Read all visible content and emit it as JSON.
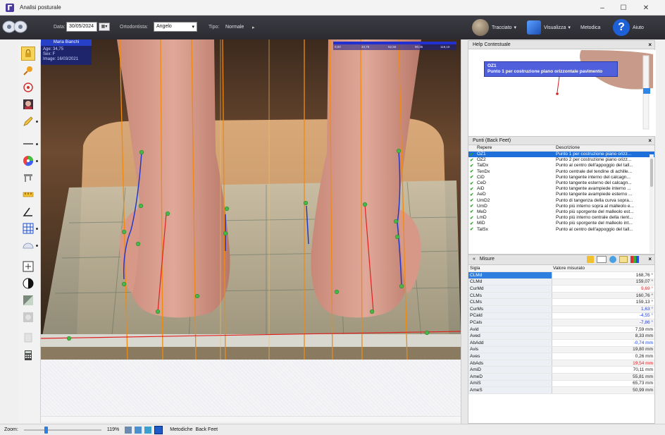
{
  "window": {
    "title": "Analisi posturale",
    "controls": [
      "–",
      "☐",
      "✕"
    ]
  },
  "toolbar": {
    "date_label": "Data:",
    "date_value": "30/05/2024",
    "orthodontist_label": "Ortodontista:",
    "orthodontist_value": "Angelo",
    "type_label": "Tipo:",
    "type_value": "Normale",
    "tracciato_label": "Tracciato",
    "visualizza_label": "Visualizza",
    "metodica_label": "Metodica",
    "aiuto_label": "Aiuto"
  },
  "patient": {
    "name": "Maria Bianchi",
    "age": "Age: 34,75",
    "sex": "Sex: F",
    "image_date": "Image: 16/03/2021"
  },
  "scale_ticks": [
    "0,00",
    "34,75",
    "62,55",
    "90,35",
    "118,10"
  ],
  "help": {
    "title": "Help Contestuale",
    "point_code": "OZ1",
    "point_desc": "Punto 1 per costruzione piano orizzontale pavimento"
  },
  "points": {
    "title": "Punti  (Back Feet)",
    "col_repere": "Repere",
    "col_desc": "Descrizione",
    "rows": [
      {
        "code": "OZ1",
        "desc": "Punto 1 per costruzione piano orizz...",
        "selected": true
      },
      {
        "code": "OZ2",
        "desc": "Punto 2 per costruzione piano orizz..."
      },
      {
        "code": "TalDx",
        "desc": "Punto al centro dell'appoggio del tall..."
      },
      {
        "code": "TenDx",
        "desc": "Punto centrale del tendine di achille..."
      },
      {
        "code": "CiD",
        "desc": "Punto tangente interno del calcagn..."
      },
      {
        "code": "CeD",
        "desc": "Punto tangente esterno del calcagn..."
      },
      {
        "code": "AiD",
        "desc": "Punto tangente avampiede interno ..."
      },
      {
        "code": "AeD",
        "desc": "Punto tangente avampiede esterno ..."
      },
      {
        "code": "UmD2",
        "desc": "Punto di tangenza della curva sopra..."
      },
      {
        "code": "UmD",
        "desc": "Punto più interno sopra al malleolo e..."
      },
      {
        "code": "MeD",
        "desc": "Punto più sporgente del malleolo est..."
      },
      {
        "code": "LmD",
        "desc": "Punto più interno centrale della rient..."
      },
      {
        "code": "MiD",
        "desc": "Punto più sporgente del malleolo int..."
      },
      {
        "code": "TalSx",
        "desc": "Punto al centro dell'appoggio del tall..."
      }
    ]
  },
  "misure": {
    "title": "Misure",
    "col_sigla": "Sigla",
    "col_valore": "Valore misurato",
    "rows": [
      {
        "sigla": "CLMd",
        "value": "168,76 °",
        "color": "#222222",
        "selected": true
      },
      {
        "sigla": "CLMd",
        "value": "159,07 °",
        "color": "#222222"
      },
      {
        "sigla": "CurMd",
        "value": "9,69 °",
        "color": "#e02020"
      },
      {
        "sigla": "CLMs",
        "value": "160,76 °",
        "color": "#222222"
      },
      {
        "sigla": "CLMs",
        "value": "159,13 °",
        "color": "#222222"
      },
      {
        "sigla": "CurMs",
        "value": "1,63 °",
        "color": "#2040e0"
      },
      {
        "sigla": "PCald",
        "value": "-4,55 °",
        "color": "#2040e0"
      },
      {
        "sigla": "PCals",
        "value": "-7,86 °",
        "color": "#2040e0"
      },
      {
        "sigla": "Avid",
        "value": "7,59 mm",
        "color": "#222222"
      },
      {
        "sigla": "Aved",
        "value": "8,33 mm",
        "color": "#222222"
      },
      {
        "sigla": "AbAdd",
        "value": "-0,74 mm",
        "color": "#2040e0"
      },
      {
        "sigla": "Avis",
        "value": "19,80 mm",
        "color": "#222222"
      },
      {
        "sigla": "Aves",
        "value": "0,26 mm",
        "color": "#222222"
      },
      {
        "sigla": "AbAds",
        "value": "19,54 mm",
        "color": "#e02020"
      },
      {
        "sigla": "AmiD",
        "value": "70,11 mm",
        "color": "#222222"
      },
      {
        "sigla": "AmeD",
        "value": "55,81 mm",
        "color": "#222222"
      },
      {
        "sigla": "AmiS",
        "value": "65,73 mm",
        "color": "#222222"
      },
      {
        "sigla": "AmeS",
        "value": "50,99 mm",
        "color": "#222222"
      }
    ]
  },
  "status": {
    "zoom_label": "Zoom:",
    "zoom_value": 119,
    "zoom_text": "119%",
    "method_label": "Metodiche",
    "method_value": "Back Feet"
  },
  "colors": {
    "accent": "#1e6fd9",
    "guide": "#f08a10",
    "trace": "#2438c8",
    "axis": "#e02020",
    "point": "#49b649"
  }
}
